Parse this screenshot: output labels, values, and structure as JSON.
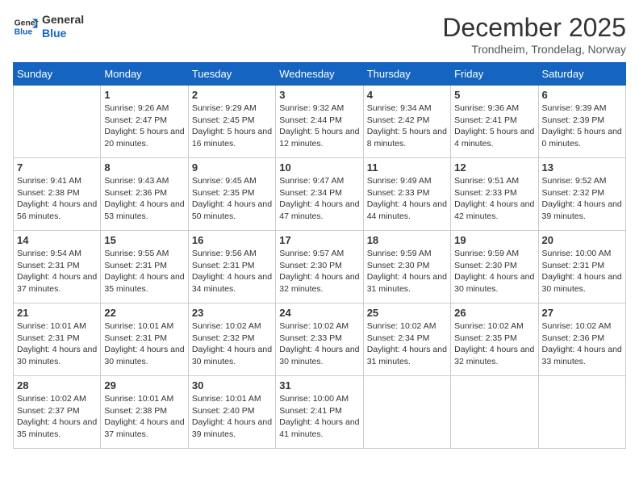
{
  "header": {
    "logo_general": "General",
    "logo_blue": "Blue",
    "month_title": "December 2025",
    "location": "Trondheim, Trondelag, Norway"
  },
  "days_of_week": [
    "Sunday",
    "Monday",
    "Tuesday",
    "Wednesday",
    "Thursday",
    "Friday",
    "Saturday"
  ],
  "weeks": [
    [
      {
        "day": "",
        "sunrise": "",
        "sunset": "",
        "daylight": ""
      },
      {
        "day": "1",
        "sunrise": "Sunrise: 9:26 AM",
        "sunset": "Sunset: 2:47 PM",
        "daylight": "Daylight: 5 hours and 20 minutes."
      },
      {
        "day": "2",
        "sunrise": "Sunrise: 9:29 AM",
        "sunset": "Sunset: 2:45 PM",
        "daylight": "Daylight: 5 hours and 16 minutes."
      },
      {
        "day": "3",
        "sunrise": "Sunrise: 9:32 AM",
        "sunset": "Sunset: 2:44 PM",
        "daylight": "Daylight: 5 hours and 12 minutes."
      },
      {
        "day": "4",
        "sunrise": "Sunrise: 9:34 AM",
        "sunset": "Sunset: 2:42 PM",
        "daylight": "Daylight: 5 hours and 8 minutes."
      },
      {
        "day": "5",
        "sunrise": "Sunrise: 9:36 AM",
        "sunset": "Sunset: 2:41 PM",
        "daylight": "Daylight: 5 hours and 4 minutes."
      },
      {
        "day": "6",
        "sunrise": "Sunrise: 9:39 AM",
        "sunset": "Sunset: 2:39 PM",
        "daylight": "Daylight: 5 hours and 0 minutes."
      }
    ],
    [
      {
        "day": "7",
        "sunrise": "Sunrise: 9:41 AM",
        "sunset": "Sunset: 2:38 PM",
        "daylight": "Daylight: 4 hours and 56 minutes."
      },
      {
        "day": "8",
        "sunrise": "Sunrise: 9:43 AM",
        "sunset": "Sunset: 2:36 PM",
        "daylight": "Daylight: 4 hours and 53 minutes."
      },
      {
        "day": "9",
        "sunrise": "Sunrise: 9:45 AM",
        "sunset": "Sunset: 2:35 PM",
        "daylight": "Daylight: 4 hours and 50 minutes."
      },
      {
        "day": "10",
        "sunrise": "Sunrise: 9:47 AM",
        "sunset": "Sunset: 2:34 PM",
        "daylight": "Daylight: 4 hours and 47 minutes."
      },
      {
        "day": "11",
        "sunrise": "Sunrise: 9:49 AM",
        "sunset": "Sunset: 2:33 PM",
        "daylight": "Daylight: 4 hours and 44 minutes."
      },
      {
        "day": "12",
        "sunrise": "Sunrise: 9:51 AM",
        "sunset": "Sunset: 2:33 PM",
        "daylight": "Daylight: 4 hours and 42 minutes."
      },
      {
        "day": "13",
        "sunrise": "Sunrise: 9:52 AM",
        "sunset": "Sunset: 2:32 PM",
        "daylight": "Daylight: 4 hours and 39 minutes."
      }
    ],
    [
      {
        "day": "14",
        "sunrise": "Sunrise: 9:54 AM",
        "sunset": "Sunset: 2:31 PM",
        "daylight": "Daylight: 4 hours and 37 minutes."
      },
      {
        "day": "15",
        "sunrise": "Sunrise: 9:55 AM",
        "sunset": "Sunset: 2:31 PM",
        "daylight": "Daylight: 4 hours and 35 minutes."
      },
      {
        "day": "16",
        "sunrise": "Sunrise: 9:56 AM",
        "sunset": "Sunset: 2:31 PM",
        "daylight": "Daylight: 4 hours and 34 minutes."
      },
      {
        "day": "17",
        "sunrise": "Sunrise: 9:57 AM",
        "sunset": "Sunset: 2:30 PM",
        "daylight": "Daylight: 4 hours and 32 minutes."
      },
      {
        "day": "18",
        "sunrise": "Sunrise: 9:59 AM",
        "sunset": "Sunset: 2:30 PM",
        "daylight": "Daylight: 4 hours and 31 minutes."
      },
      {
        "day": "19",
        "sunrise": "Sunrise: 9:59 AM",
        "sunset": "Sunset: 2:30 PM",
        "daylight": "Daylight: 4 hours and 30 minutes."
      },
      {
        "day": "20",
        "sunrise": "Sunrise: 10:00 AM",
        "sunset": "Sunset: 2:31 PM",
        "daylight": "Daylight: 4 hours and 30 minutes."
      }
    ],
    [
      {
        "day": "21",
        "sunrise": "Sunrise: 10:01 AM",
        "sunset": "Sunset: 2:31 PM",
        "daylight": "Daylight: 4 hours and 30 minutes."
      },
      {
        "day": "22",
        "sunrise": "Sunrise: 10:01 AM",
        "sunset": "Sunset: 2:31 PM",
        "daylight": "Daylight: 4 hours and 30 minutes."
      },
      {
        "day": "23",
        "sunrise": "Sunrise: 10:02 AM",
        "sunset": "Sunset: 2:32 PM",
        "daylight": "Daylight: 4 hours and 30 minutes."
      },
      {
        "day": "24",
        "sunrise": "Sunrise: 10:02 AM",
        "sunset": "Sunset: 2:33 PM",
        "daylight": "Daylight: 4 hours and 30 minutes."
      },
      {
        "day": "25",
        "sunrise": "Sunrise: 10:02 AM",
        "sunset": "Sunset: 2:34 PM",
        "daylight": "Daylight: 4 hours and 31 minutes."
      },
      {
        "day": "26",
        "sunrise": "Sunrise: 10:02 AM",
        "sunset": "Sunset: 2:35 PM",
        "daylight": "Daylight: 4 hours and 32 minutes."
      },
      {
        "day": "27",
        "sunrise": "Sunrise: 10:02 AM",
        "sunset": "Sunset: 2:36 PM",
        "daylight": "Daylight: 4 hours and 33 minutes."
      }
    ],
    [
      {
        "day": "28",
        "sunrise": "Sunrise: 10:02 AM",
        "sunset": "Sunset: 2:37 PM",
        "daylight": "Daylight: 4 hours and 35 minutes."
      },
      {
        "day": "29",
        "sunrise": "Sunrise: 10:01 AM",
        "sunset": "Sunset: 2:38 PM",
        "daylight": "Daylight: 4 hours and 37 minutes."
      },
      {
        "day": "30",
        "sunrise": "Sunrise: 10:01 AM",
        "sunset": "Sunset: 2:40 PM",
        "daylight": "Daylight: 4 hours and 39 minutes."
      },
      {
        "day": "31",
        "sunrise": "Sunrise: 10:00 AM",
        "sunset": "Sunset: 2:41 PM",
        "daylight": "Daylight: 4 hours and 41 minutes."
      },
      {
        "day": "",
        "sunrise": "",
        "sunset": "",
        "daylight": ""
      },
      {
        "day": "",
        "sunrise": "",
        "sunset": "",
        "daylight": ""
      },
      {
        "day": "",
        "sunrise": "",
        "sunset": "",
        "daylight": ""
      }
    ]
  ]
}
